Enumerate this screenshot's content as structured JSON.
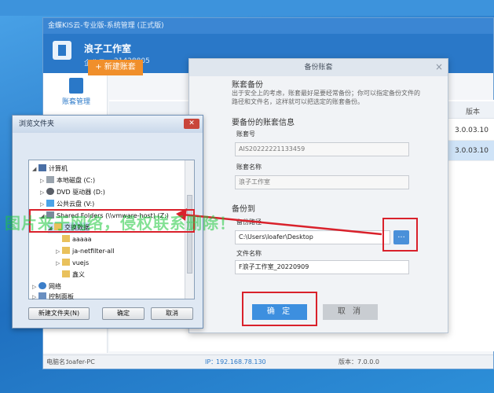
{
  "app": {
    "title": "金蝶KIS云-专业版-系统管理 (正式版)",
    "company_name": "浪子工作室",
    "company_id_label": "企业号：",
    "company_id": "21428805",
    "nav_account": "账套管理",
    "new_account_button": "+ 新建账套",
    "table": {
      "col_version": "版本",
      "rows": [
        {
          "version": "3.0.03.10"
        },
        {
          "version": "3.0.03.10"
        }
      ]
    },
    "status": {
      "pc_label": "电脑名：",
      "pc_name": "loafer-PC",
      "ip_label": "IP：",
      "ip": "192.168.78.130",
      "version_label": "版本：",
      "version": "7.0.0.0"
    }
  },
  "backup_dialog": {
    "title": "备份账套",
    "section_title": "账套备份",
    "hint": "出于安全上的考虑，账套最好是要经常备份；你可以指定备份文件的路径和文件名，这样就可以把选定的账套备份。",
    "info_heading": "要备份的账套信息",
    "account_no_label": "账套号",
    "account_no": "AIS20222221133459",
    "account_name_label": "账套名称",
    "account_name": "浪子工作室",
    "backup_to_heading": "备份到",
    "path_label": "备份路径",
    "path_value": "C:\\Users\\loafer\\Desktop",
    "browse_label": "...",
    "filename_label": "文件名称",
    "filename_value": "F浪子工作室_20220909",
    "ok_label": "确 定",
    "cancel_label": "取 消"
  },
  "browse_dialog": {
    "title": "浏览文件夹",
    "close_label": "✕",
    "tree": [
      {
        "label": "计算机",
        "icon": "computer-icon"
      },
      {
        "label": "本地磁盘 (C:)",
        "icon": "drive-icon"
      },
      {
        "label": "DVD 驱动器 (D:)",
        "icon": "dvd-icon"
      },
      {
        "label": "公共云盘 (V:)",
        "icon": "cloud-drive-icon"
      },
      {
        "label": "Shared Folders (\\\\vmware-host) (Z:)",
        "icon": "share-icon"
      },
      {
        "label": "交换数据",
        "icon": "folder-icon"
      },
      {
        "label": "aaaaa",
        "icon": "folder-icon"
      },
      {
        "label": "ja-netfilter-all",
        "icon": "folder-icon"
      },
      {
        "label": "vuejs",
        "icon": "folder-icon"
      },
      {
        "label": "鑫义",
        "icon": "folder-icon"
      },
      {
        "label": "网络",
        "icon": "network-icon"
      },
      {
        "label": "控制面板",
        "icon": "control-panel-icon"
      }
    ],
    "new_folder_label": "新建文件夹(N)",
    "ok_label": "确定",
    "cancel_label": "取消"
  },
  "watermark": "图片来于网络，侵权联系删除！",
  "colors": {
    "annotation_red": "#d9212b",
    "brand_blue": "#2a78c8",
    "new_button_orange": "#f08f2b"
  }
}
